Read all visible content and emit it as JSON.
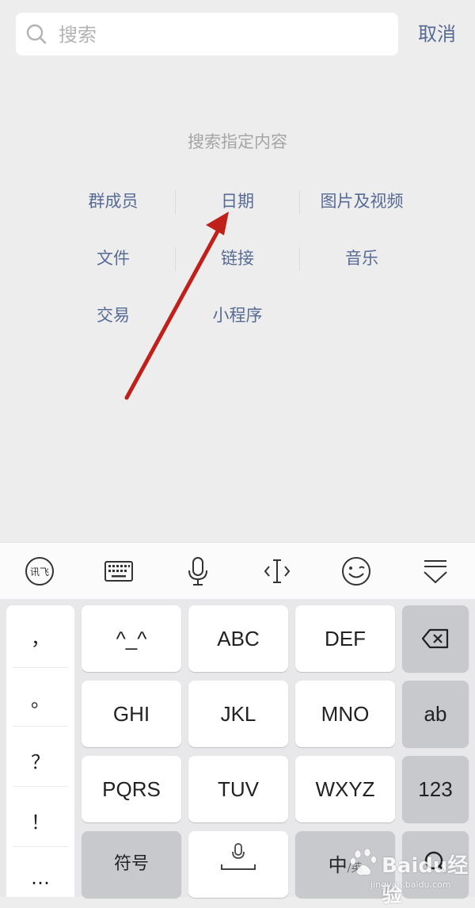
{
  "search": {
    "placeholder": "搜索",
    "cancel_label": "取消"
  },
  "section_title": "搜索指定内容",
  "categories": [
    "群成员",
    "日期",
    "图片及视频",
    "文件",
    "链接",
    "音乐",
    "交易",
    "小程序"
  ],
  "keyboard": {
    "toolbar": [
      "xunfei-logo-icon",
      "keyboard-icon",
      "microphone-icon",
      "text-cursor-icon",
      "emoji-icon",
      "collapse-keyboard-icon"
    ],
    "toolbar_logo_text": "讯飞",
    "punctuation": [
      "，",
      "。",
      "？",
      "！",
      "…"
    ],
    "keys": {
      "emoticon": "^_^",
      "abc": "ABC",
      "def": "DEF",
      "ghi": "GHI",
      "jkl": "JKL",
      "mno": "MNO",
      "ab": "ab",
      "pqrs": "PQRS",
      "tuv": "TUV",
      "wxyz": "WXYZ",
      "num": "123",
      "symbol": "符号",
      "lang_main": "中",
      "lang_sub": "/英"
    }
  },
  "watermark": {
    "text": "Baidu经验",
    "sub": "jingyan.baidu.com"
  },
  "colors": {
    "link": "#576b95",
    "arrow": "#c0201a",
    "background": "#ededed"
  }
}
